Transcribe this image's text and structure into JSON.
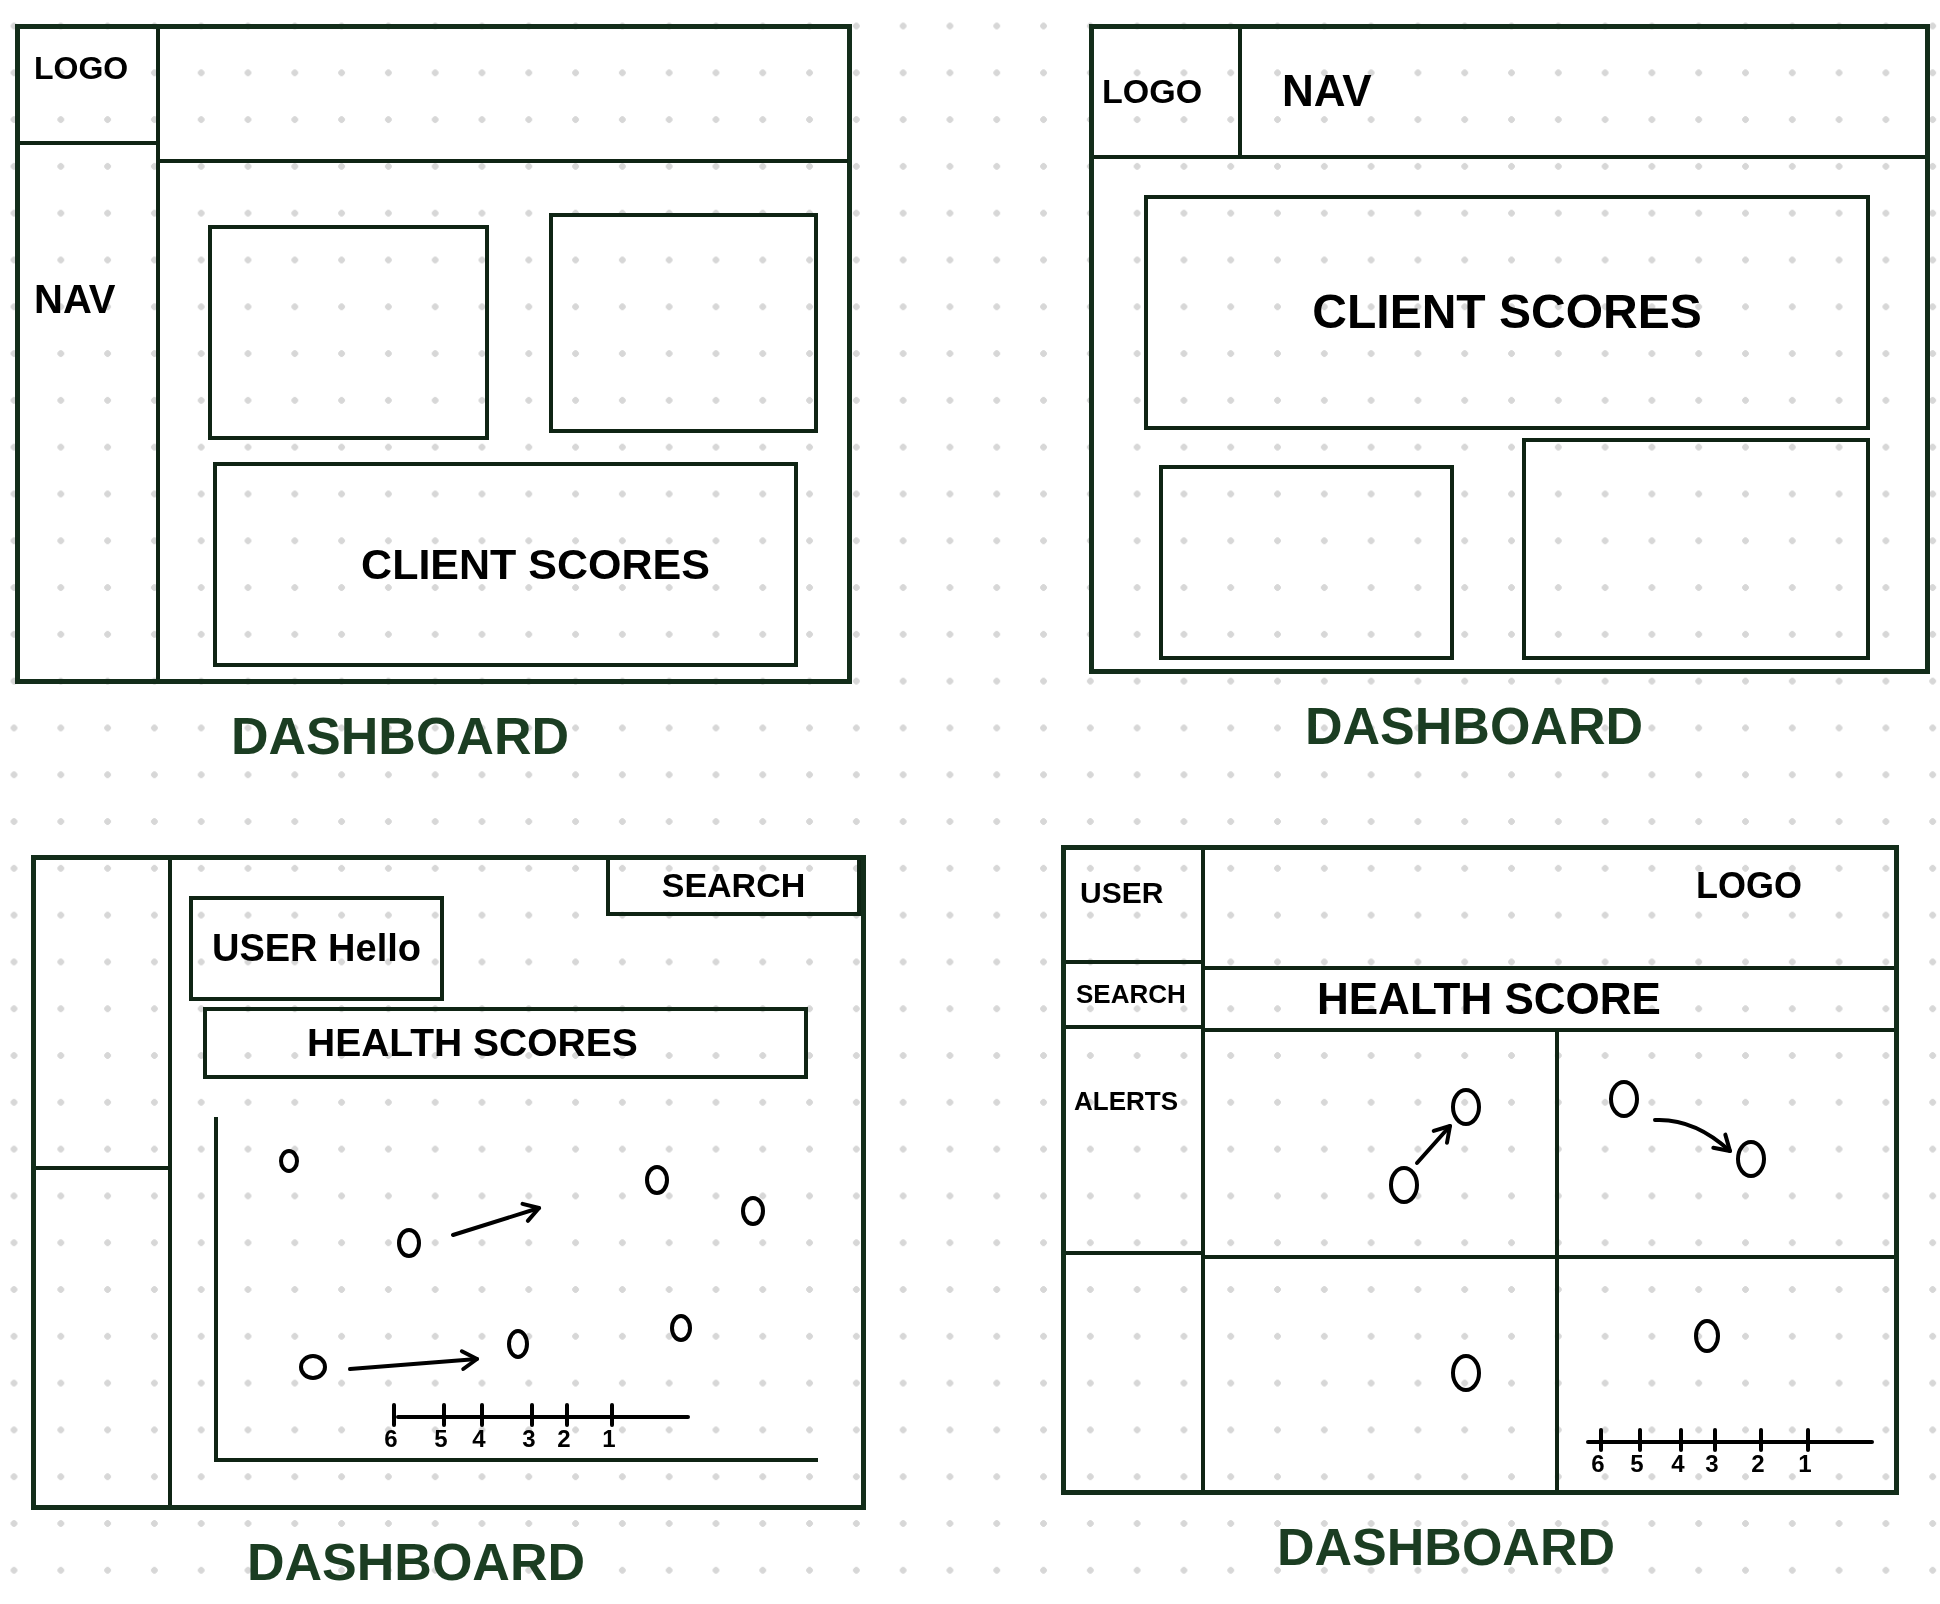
{
  "sketches": [
    {
      "kind": "sidebar-nav",
      "logo": "LOGO",
      "nav": "NAV",
      "panel_title": "CLIENT SCORES",
      "caption": "DASHBOARD"
    },
    {
      "kind": "top-nav",
      "logo": "LOGO",
      "nav": "NAV",
      "panel_title": "CLIENT SCORES",
      "caption": "DASHBOARD"
    },
    {
      "kind": "scatter",
      "search": "SEARCH",
      "greeting": "USER Hello",
      "panel_title": "HEALTH SCORES",
      "scale": [
        "6",
        "5",
        "4",
        "3",
        "2",
        "1"
      ],
      "caption": "DASHBOARD"
    },
    {
      "kind": "quad-grid",
      "user": "USER",
      "search": "SEARCH",
      "alerts": "ALERTS",
      "logo": "LOGO",
      "panel_title": "HEALTH SCORE",
      "scale": [
        "6",
        "5",
        "4",
        "3",
        "2",
        "1"
      ],
      "caption": "DASHBOARD"
    }
  ]
}
